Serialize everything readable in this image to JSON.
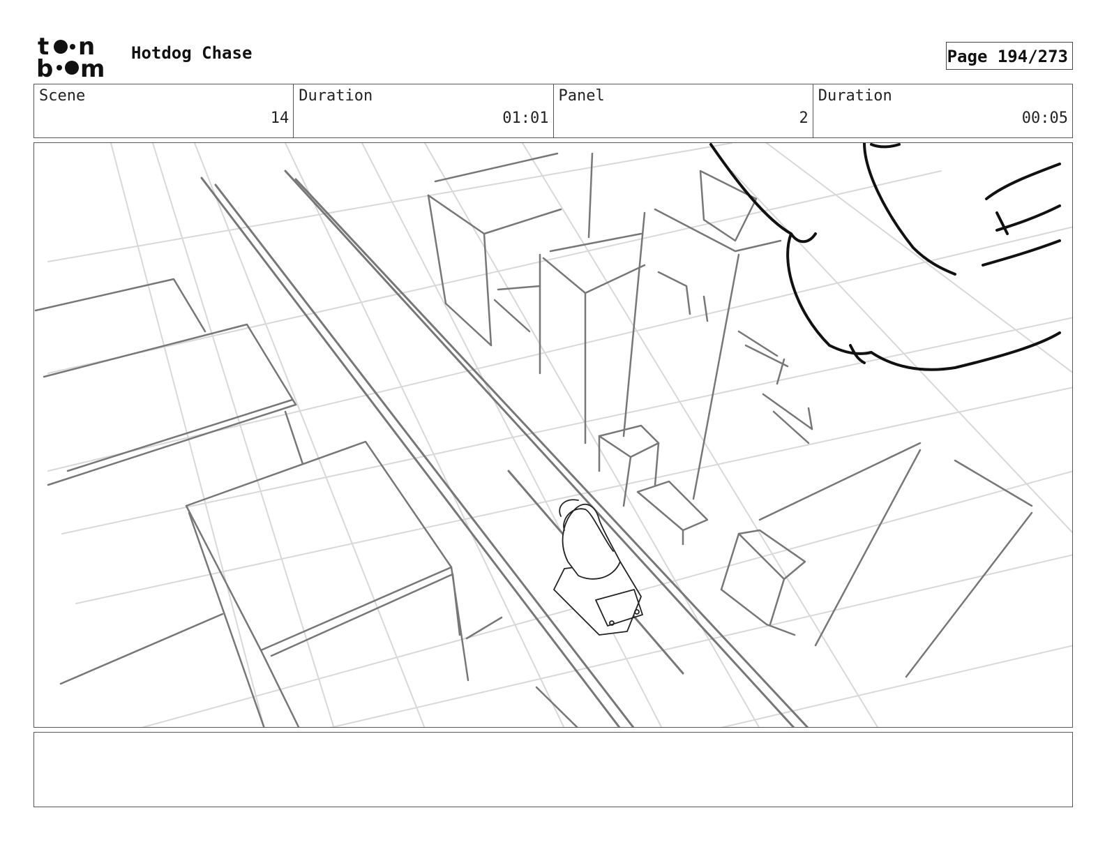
{
  "header": {
    "logo_text": "toonboom",
    "title": "Hotdog Chase",
    "page_label": "Page 194/273"
  },
  "info": [
    {
      "label": "Scene",
      "value": "14"
    },
    {
      "label": "Duration",
      "value": "01:01"
    },
    {
      "label": "Panel",
      "value": "2"
    },
    {
      "label": "Duration",
      "value": "00:05"
    }
  ],
  "notes": {
    "text": ""
  }
}
